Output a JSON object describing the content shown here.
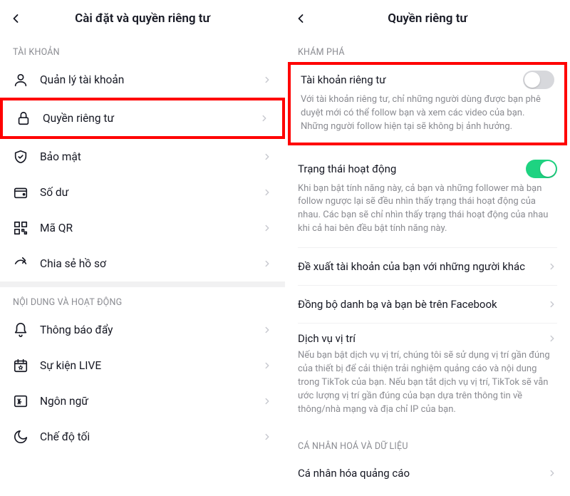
{
  "left": {
    "title": "Cài đặt và quyền riêng tư",
    "section_account": "TÀI KHOẢN",
    "rows_account": [
      {
        "label": "Quản lý tài khoản"
      },
      {
        "label": "Quyền riêng tư"
      },
      {
        "label": "Bảo mật"
      },
      {
        "label": "Số dư"
      },
      {
        "label": "Mã QR"
      },
      {
        "label": "Chia sẻ hồ sơ"
      }
    ],
    "section_content": "NỘI DUNG VÀ HOẠT ĐỘNG",
    "rows_content": [
      {
        "label": "Thông báo đẩy"
      },
      {
        "label": "Sự kiện LIVE"
      },
      {
        "label": "Ngôn ngữ"
      },
      {
        "label": "Chế độ tối"
      }
    ]
  },
  "right": {
    "title": "Quyền riêng tư",
    "section_discover": "KHÁM PHÁ",
    "private_account": {
      "title": "Tài khoản riêng tư",
      "desc": "Với tài khoản riêng tư, chỉ những người dùng được bạn phê duyệt mới có thể follow bạn và xem các video của bạn. Những người follow hiện tại sẽ không bị ảnh hưởng."
    },
    "activity_status": {
      "title": "Trạng thái hoạt động",
      "desc": "Khi bạn bật tính năng này, cả bạn và những follower mà bạn follow ngược lại sẽ đều nhìn thấy trạng thái hoạt động của nhau. Các bạn sẽ chỉ nhìn thấy trạng thái hoạt động của nhau khi cả hai bên đều bật tính năng này."
    },
    "suggest_account": "Đề xuất tài khoản của bạn với những người khác",
    "sync_contacts": "Đồng bộ danh bạ và bạn bè trên Facebook",
    "location": {
      "title": "Dịch vụ vị trí",
      "desc": "Nếu bạn bật dịch vụ vị trí, chúng tôi sẽ sử dụng vị trí gần đúng của thiết bị để cải thiện trải nghiệm quảng cáo và nội dung trong TikTok của bạn. Nếu bạn tắt dịch vụ vị trí, TikTok sẽ vẫn ước lượng vị trí gần đúng của bạn dựa trên thông tin về thông/nhà mạng và địa chỉ IP của bạn."
    },
    "section_personal": "CÁ NHÂN HOÁ VÀ DỮ LIỆU",
    "ad_personal": "Cá nhân hóa quảng cáo"
  }
}
